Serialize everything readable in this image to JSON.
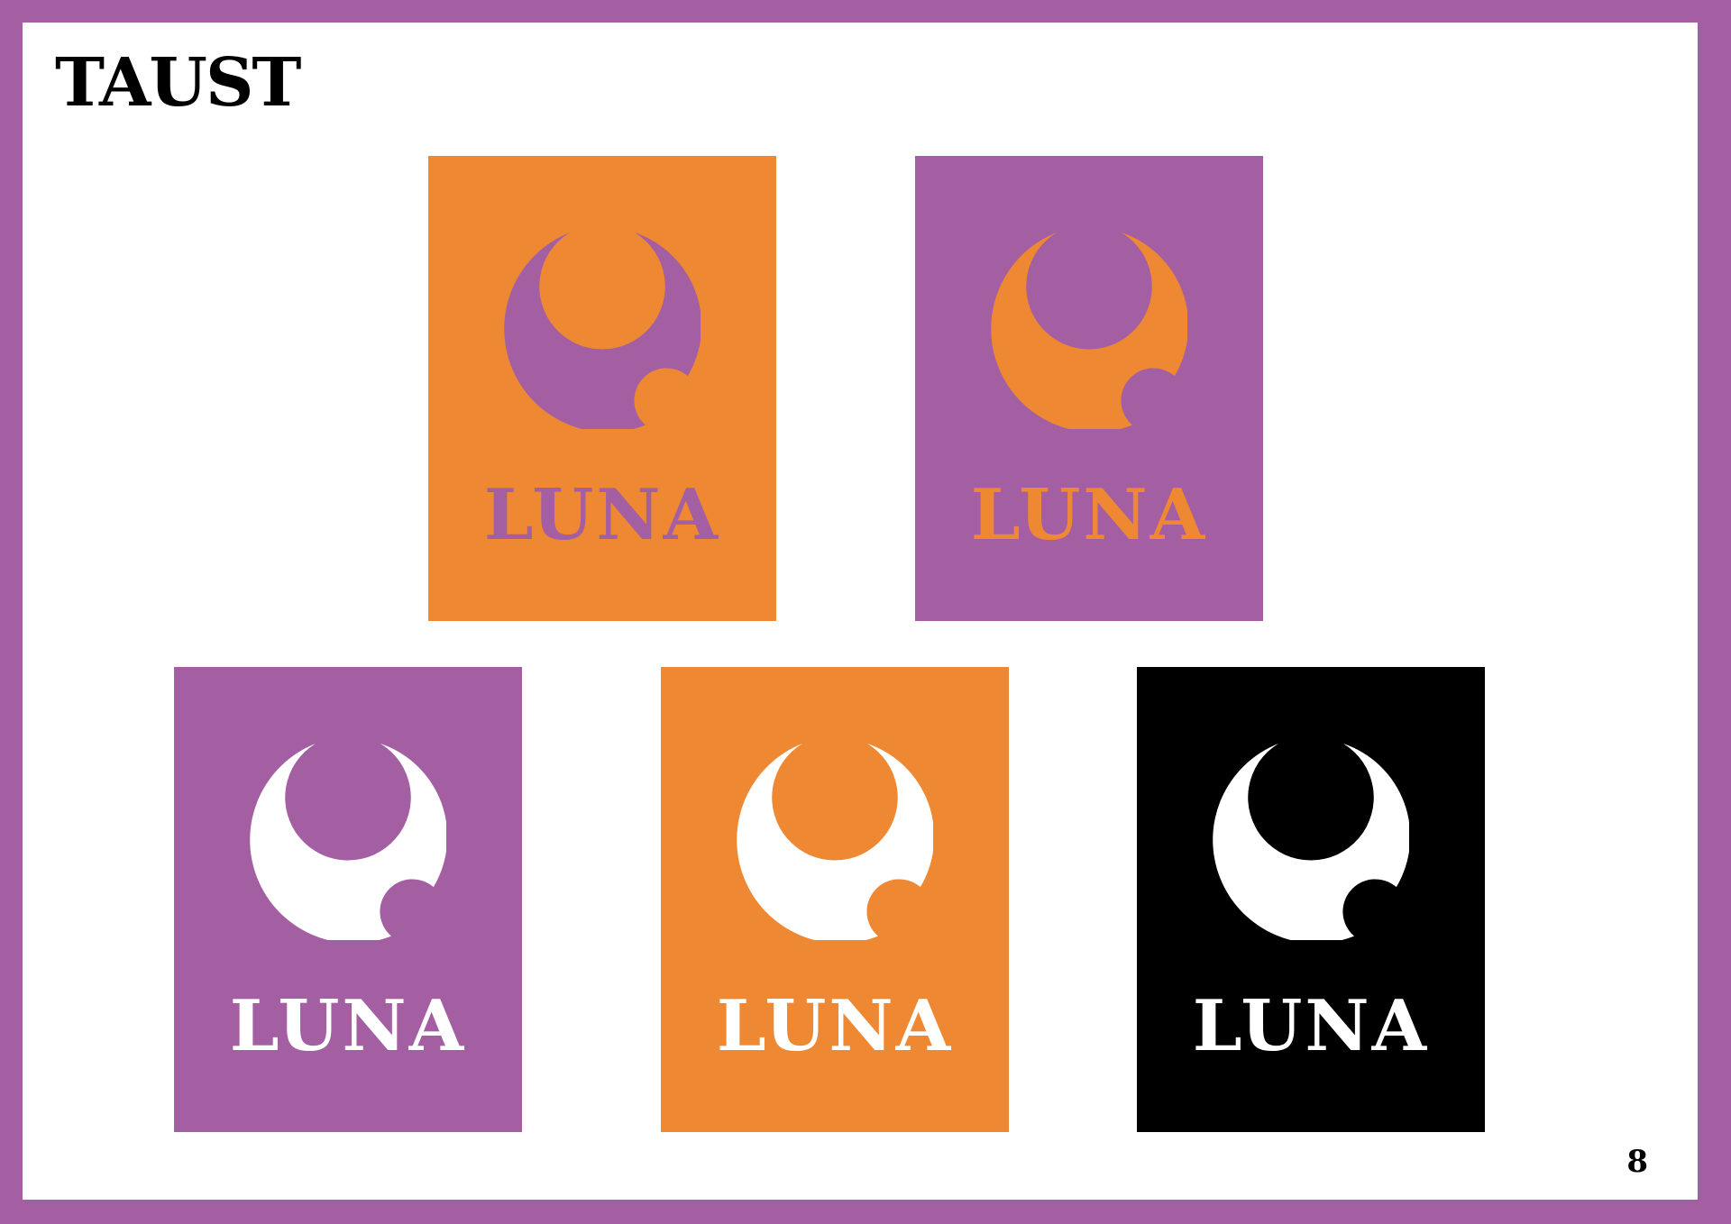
{
  "page": {
    "title": "TAUST",
    "page_number": "8",
    "frame_color": "#a45fa3"
  },
  "colors": {
    "purple": "#a45fa3",
    "orange": "#ef8832",
    "black": "#000000",
    "white": "#ffffff"
  },
  "cards": [
    {
      "label": "LUNA",
      "background": "#ef8832",
      "logo_color": "#a45fa3",
      "text_color": "#a45fa3",
      "icon": "crescent-moon-icon"
    },
    {
      "label": "LUNA",
      "background": "#a45fa3",
      "logo_color": "#ef8832",
      "text_color": "#ef8832",
      "icon": "crescent-moon-icon"
    },
    {
      "label": "LUNA",
      "background": "#a45fa3",
      "logo_color": "#ffffff",
      "text_color": "#ffffff",
      "icon": "crescent-moon-icon"
    },
    {
      "label": "LUNA",
      "background": "#ef8832",
      "logo_color": "#ffffff",
      "text_color": "#ffffff",
      "icon": "crescent-moon-icon"
    },
    {
      "label": "LUNA",
      "background": "#000000",
      "logo_color": "#ffffff",
      "text_color": "#ffffff",
      "icon": "crescent-moon-icon"
    }
  ]
}
